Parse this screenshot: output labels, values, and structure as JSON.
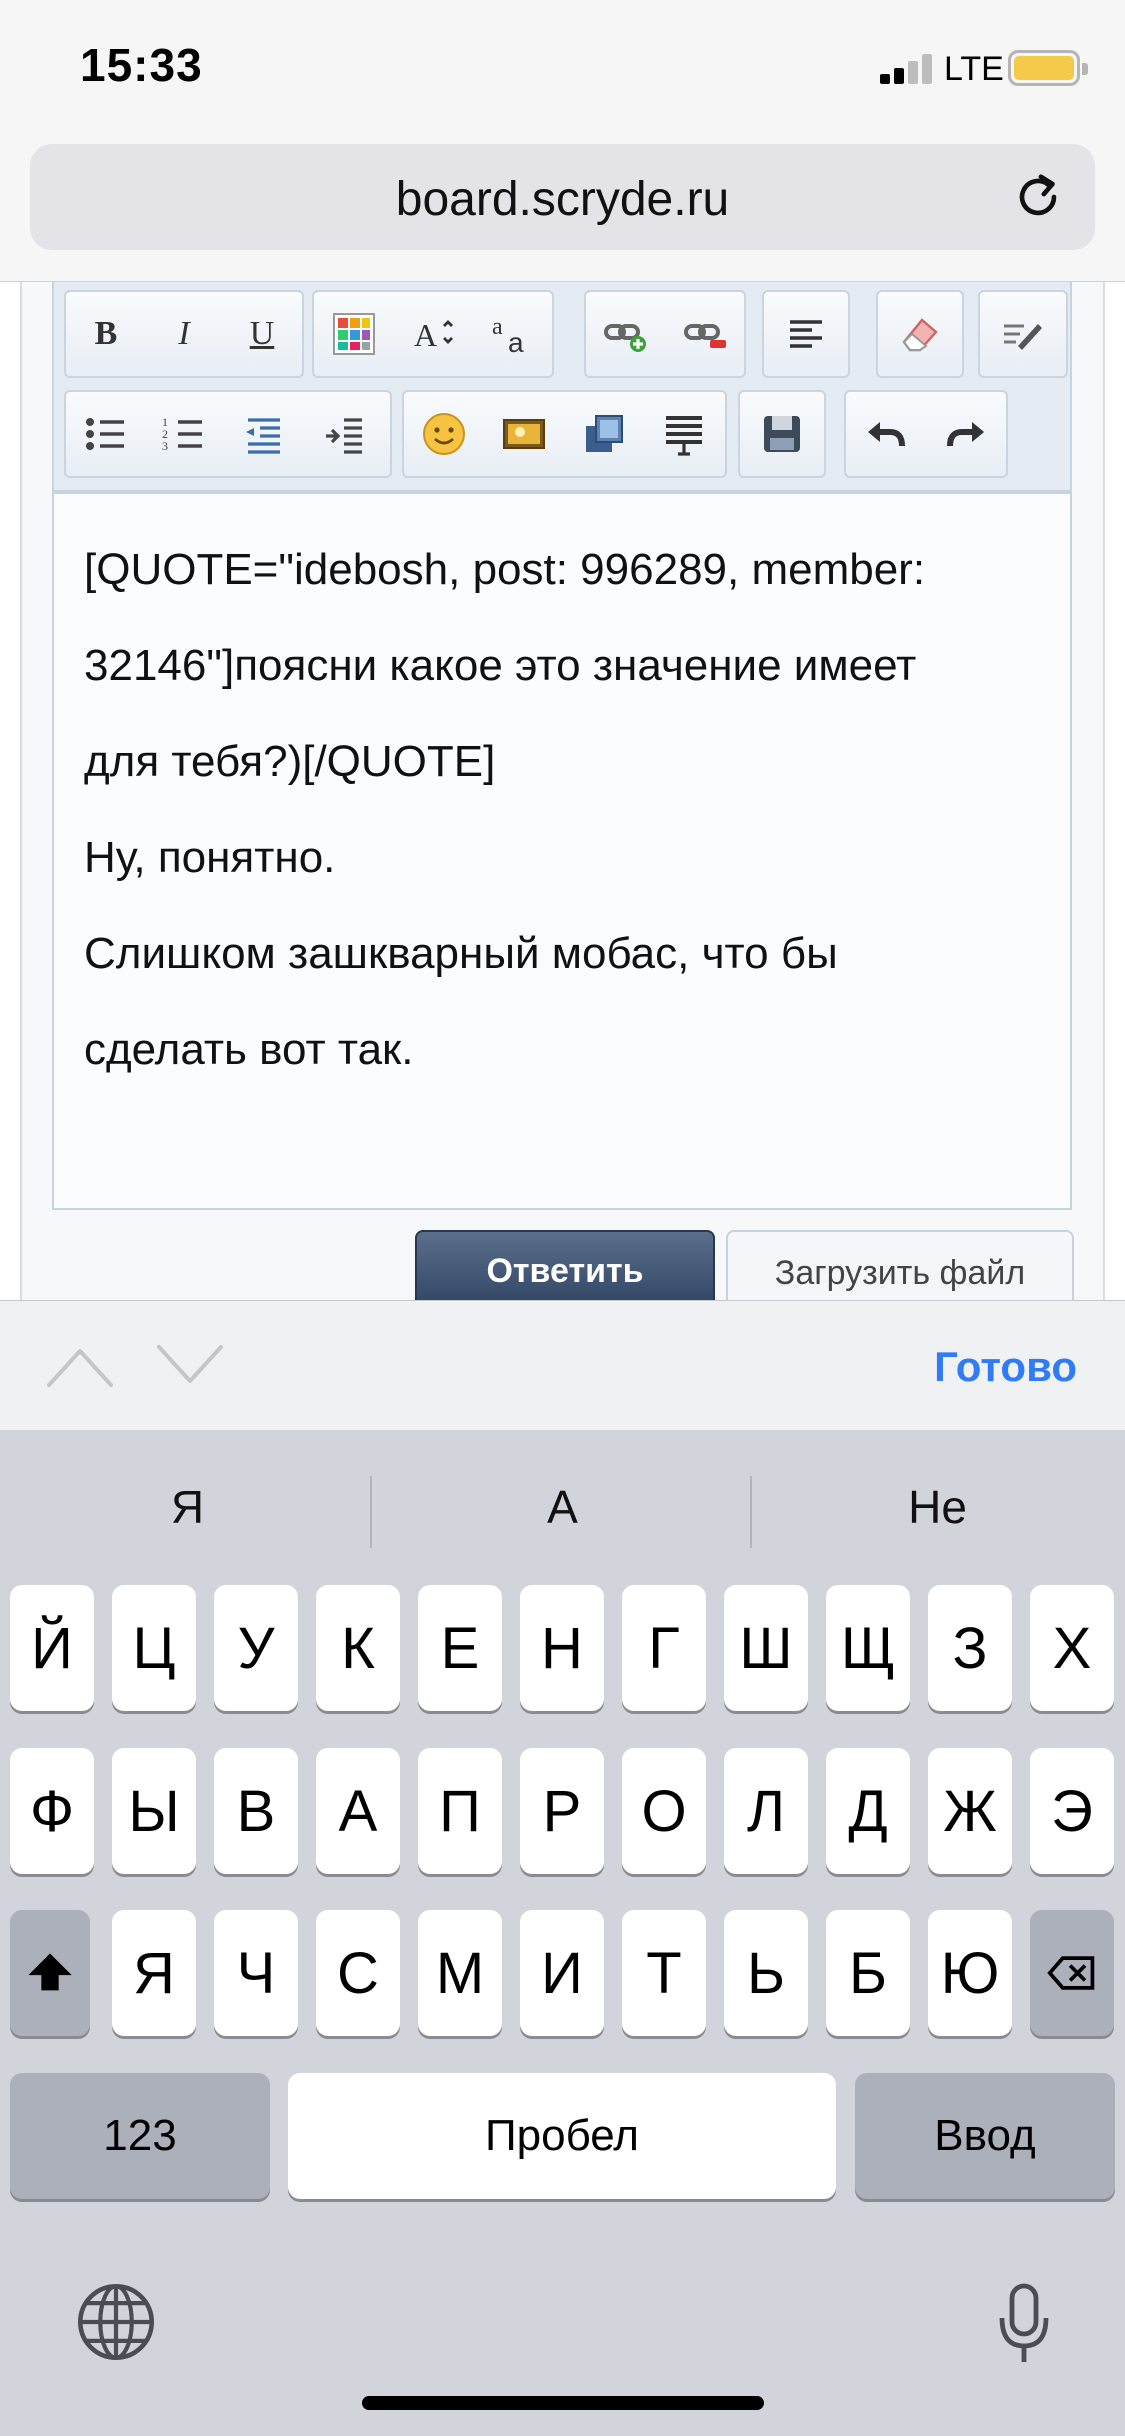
{
  "status_bar": {
    "time": "15:33",
    "network": "LTE"
  },
  "browser": {
    "url": "board.scryde.ru"
  },
  "editor": {
    "toolbar_buttons": {
      "bold": "B",
      "italic": "I",
      "underline": "U"
    },
    "lines": [
      "[QUOTE=\"idebosh, post: 996289, member:",
      "32146\"]поясни какое это значение имеет",
      "для тебя?)[/QUOTE]",
      "Ну, понятно.",
      "Слишком зашкварный мобас, что бы",
      "сделать вот так."
    ],
    "reply_label": "Ответить",
    "upload_label": "Загрузить файл"
  },
  "accessory": {
    "done_label": "Готово"
  },
  "keyboard": {
    "suggestions": [
      "Я",
      "А",
      "Не"
    ],
    "row1": [
      "Й",
      "Ц",
      "У",
      "К",
      "Е",
      "Н",
      "Г",
      "Ш",
      "Щ",
      "З",
      "Х"
    ],
    "row2": [
      "Ф",
      "Ы",
      "В",
      "А",
      "П",
      "Р",
      "О",
      "Л",
      "Д",
      "Ж",
      "Э"
    ],
    "row3": [
      "Я",
      "Ч",
      "С",
      "М",
      "И",
      "Т",
      "Ь",
      "Б",
      "Ю"
    ],
    "numbers_label": "123",
    "space_label": "Пробел",
    "return_label": "Ввод"
  }
}
